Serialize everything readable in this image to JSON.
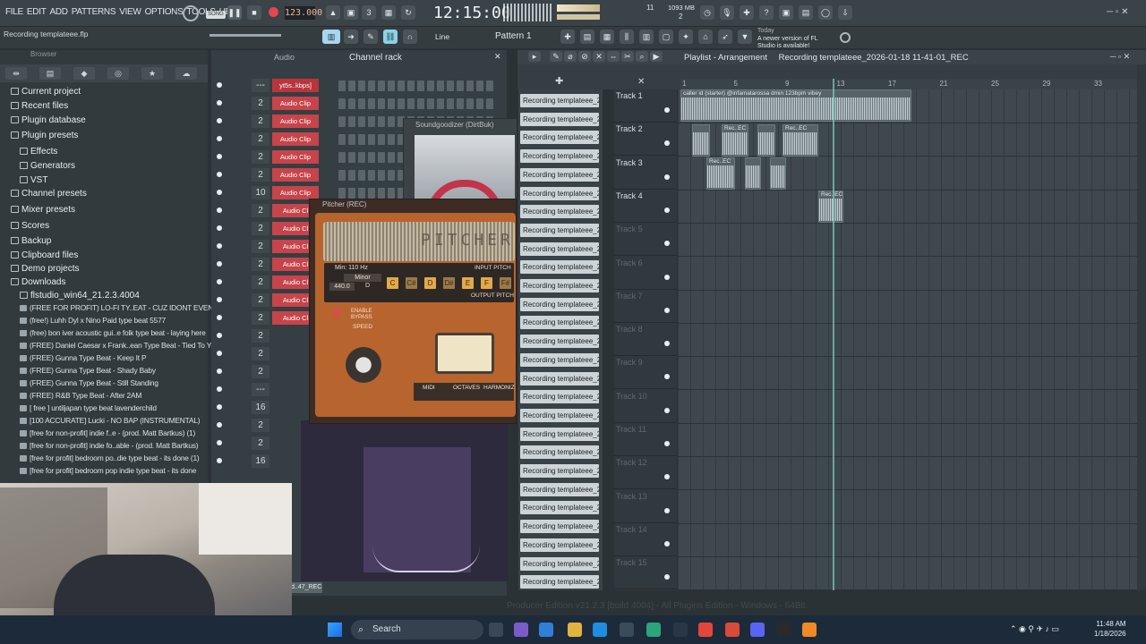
{
  "menu": {
    "items": [
      "FILE",
      "EDIT",
      "ADD",
      "PATTERNS",
      "VIEW",
      "OPTIONS",
      "TOOLS",
      "HELP"
    ]
  },
  "transport": {
    "mode": "SONG",
    "bpm": "123.000",
    "time": "12:15:00",
    "cpu": "11",
    "mem": "1093 MB",
    "voices": "2"
  },
  "hint": {
    "filename": "Recording templateee.flp",
    "update_label": "Today",
    "update_text": "A newer version of FL Studio is available!"
  },
  "toolbar": {
    "snap": "Line",
    "pattern": "Pattern 1"
  },
  "browser": {
    "title": "Browser",
    "items": [
      {
        "label": "Current project",
        "kind": "folder"
      },
      {
        "label": "Recent files",
        "kind": "folder"
      },
      {
        "label": "Plugin database",
        "kind": "folder"
      },
      {
        "label": "Plugin presets",
        "kind": "folder"
      },
      {
        "label": "Effects",
        "kind": "sub"
      },
      {
        "label": "Generators",
        "kind": "sub"
      },
      {
        "label": "VST",
        "kind": "sub"
      },
      {
        "label": "Channel presets",
        "kind": "folder"
      },
      {
        "label": "Mixer presets",
        "kind": "folder"
      },
      {
        "label": "Scores",
        "kind": "folder"
      },
      {
        "label": "Backup",
        "kind": "folder"
      },
      {
        "label": "Clipboard files",
        "kind": "folder"
      },
      {
        "label": "Demo projects",
        "kind": "folder"
      },
      {
        "label": "Downloads",
        "kind": "folder"
      },
      {
        "label": "flstudio_win64_21.2.3.4004",
        "kind": "sub"
      },
      {
        "label": "(FREE FOR PROFIT) LO-FI TY..EAT - CUZ IDONT EVEN KNOW",
        "kind": "file"
      },
      {
        "label": "(free!) Luhh Dyl x Nino Paid type beat 5577",
        "kind": "file"
      },
      {
        "label": "(free) bon iver  acoustic gui..e folk type beat - laying here",
        "kind": "file"
      },
      {
        "label": "(FREE) Daniel Caesar x Frank..ean Type Beat - Tied To You",
        "kind": "file"
      },
      {
        "label": "(FREE) Gunna Type Beat - Keep It P",
        "kind": "file"
      },
      {
        "label": "(FREE) Gunna Type Beat - Shady Baby",
        "kind": "file"
      },
      {
        "label": "(FREE) Gunna Type Beat - Still Standing",
        "kind": "file"
      },
      {
        "label": "(FREE) R&B Type Beat - After 2AM",
        "kind": "file"
      },
      {
        "label": "[ free ] untiljapan type beat lavenderchild",
        "kind": "file"
      },
      {
        "label": "[100 ACCURATE] Lucki - NO BAP (INSTRUMENTAL)",
        "kind": "file"
      },
      {
        "label": "[free for non-profit] indie f..e - (prod. Matt Bartkus) (1)",
        "kind": "file"
      },
      {
        "label": "[free for non-profit] indie fo..able - (prod. Matt Bartkus)",
        "kind": "file"
      },
      {
        "label": "[free for profit] bedroom po..die type beat - its done (1)",
        "kind": "file"
      },
      {
        "label": "[free for profit] bedroom pop  indie type beat - its done",
        "kind": "file"
      }
    ]
  },
  "channel_rack": {
    "title": "Channel rack",
    "filter": "Audio",
    "rows": [
      {
        "num": "---",
        "name": "yt5s..kbps]"
      },
      {
        "num": "2",
        "name": "Audio Clip"
      },
      {
        "num": "2",
        "name": "Audio Clip"
      },
      {
        "num": "2",
        "name": "Audio Clip"
      },
      {
        "num": "2",
        "name": "Audio Clip"
      },
      {
        "num": "2",
        "name": "Audio Clip"
      },
      {
        "num": "10",
        "name": "Audio Clip"
      },
      {
        "num": "2",
        "name": "Audio Cl"
      },
      {
        "num": "2",
        "name": "Audio Cl"
      },
      {
        "num": "2",
        "name": "Audio Cl"
      },
      {
        "num": "2",
        "name": "Audio Cl"
      },
      {
        "num": "2",
        "name": "Audio Cl"
      },
      {
        "num": "2",
        "name": "Audio Cl"
      },
      {
        "num": "2",
        "name": "Audio Cl"
      },
      {
        "num": "2",
        "name": ""
      },
      {
        "num": "2",
        "name": ""
      },
      {
        "num": "2",
        "name": ""
      },
      {
        "num": "---",
        "name": ""
      },
      {
        "num": "16",
        "name": ""
      },
      {
        "num": "2",
        "name": ""
      },
      {
        "num": "2",
        "name": ""
      },
      {
        "num": "16",
        "name": ""
      }
    ],
    "bottom_label": "rd..47_REC"
  },
  "plugins": {
    "soundgoodizer_title": "Soundgoodizer (DirtBuk)",
    "pitcher_title": "Pitcher (REC)",
    "pitcher_logo": "PITCHER",
    "min_hz": "Min: 110 Hz",
    "scale": "Minor",
    "tune": "440.0",
    "key_root": "D",
    "keys": [
      "C",
      "C#",
      "D",
      "D#",
      "E",
      "F",
      "F#"
    ],
    "input_label": "INPUT PITCH",
    "output_label": "OUTPUT PITCH",
    "bypass": "ENABLE BYPASS",
    "speed": "SPEED",
    "tabs": [
      "MIDI",
      "OCTAVES",
      "HARMONIZ"
    ]
  },
  "playlist": {
    "title": "Playlist - Arrangement",
    "project": "Recording templateee_2026-01-18 11-41-01_REC",
    "ruler": [
      "1",
      "5",
      "9",
      "13",
      "17",
      "21",
      "25",
      "29",
      "33"
    ],
    "pattern_names": [
      "Recording templateee_2",
      "Recording templateee_2",
      "Recording templateee_2",
      "Recording templateee_2",
      "Recording templateee_2",
      "Recording templateee_2",
      "Recording templateee_2",
      "Recording templateee_2",
      "Recording templateee_2",
      "Recording templateee_2",
      "Recording templateee_2",
      "Recording templateee_2",
      "Recording templateee_2",
      "Recording templateee_2",
      "Recording templateee_2",
      "Recording templateee_2",
      "Recording templateee_2",
      "Recording templateee_2",
      "Recording templateee_2",
      "Recording templateee_2",
      "Recording templateee_2",
      "Recording templateee_2",
      "Recording templateee_2",
      "Recording templateee_2",
      "Recording templateee_2",
      "Recording templateee_2",
      "Recording templateee_2"
    ],
    "tracks": [
      "Track 1",
      "Track 2",
      "Track 3",
      "Track 4",
      "Track 5",
      "Track 6",
      "Track 7",
      "Track 8",
      "Track 9",
      "Track 10",
      "Track 11",
      "Track 12",
      "Track 13",
      "Track 14",
      "Track 15"
    ],
    "clip_track1": "caller id (starter) @infamatarossa dmin 123bpm vibey",
    "clip_rec": "Rec..EC"
  },
  "status": "Producer Edition v21.2.3 [build 4004] - All Plugins Edition - Windows - 64Bit",
  "taskbar": {
    "search": "Search",
    "time": "11:48 AM",
    "date": "1/18/2026"
  }
}
